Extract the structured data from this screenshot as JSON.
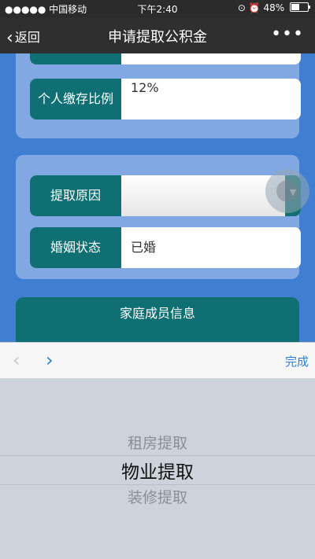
{
  "status_bar": {
    "carrier": "●●●●● 中国移动",
    "time": "下午2:40",
    "battery": "48%",
    "battery_level": 0.48
  },
  "nav": {
    "back_label": "返回",
    "title": "申请提取公积金",
    "more": "•••"
  },
  "form": {
    "personal_rate_label": "个人缴存比例",
    "personal_rate_value": "12%",
    "reason_label": "提取原因",
    "reason_value": "",
    "marital_label": "婚姻状态",
    "marital_value": "已婚",
    "family_header": "家庭成员信息"
  },
  "toolbar": {
    "done_label": "完成"
  },
  "picker": {
    "options": [
      "租房提取",
      "物业提取",
      "装修提取"
    ],
    "selected": "物业提取"
  },
  "colors": {
    "nav_bg": "#2f2f2f",
    "label_bg": "#0f6f72",
    "page_bg": "#3f7ed0",
    "card_bg": "#82a8e3",
    "accent": "#2d7fd6"
  }
}
